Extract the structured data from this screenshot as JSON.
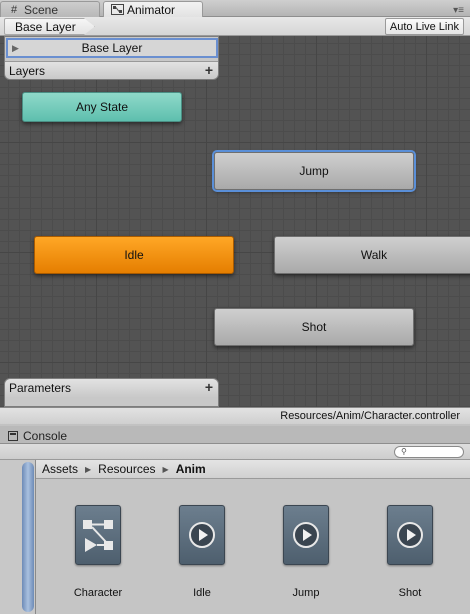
{
  "tabs": [
    {
      "label": "Scene",
      "icon": "scene-grid-icon"
    },
    {
      "label": "Animator",
      "icon": "animator-icon"
    }
  ],
  "animator": {
    "breadcrumb": "Base Layer",
    "auto_live_link": "Auto Live Link",
    "layers": {
      "items": [
        "Base Layer"
      ],
      "header": "Layers",
      "add": "+"
    },
    "states": [
      {
        "name": "Any State",
        "kind": "any-state"
      },
      {
        "name": "Jump",
        "kind": "normal",
        "selected": true
      },
      {
        "name": "Idle",
        "kind": "default"
      },
      {
        "name": "Walk",
        "kind": "normal"
      },
      {
        "name": "Shot",
        "kind": "normal"
      }
    ],
    "parameters": {
      "header": "Parameters",
      "add": "+"
    },
    "path": "Resources/Anim/Character.controller"
  },
  "console": {
    "label": "Console",
    "icon": "console-icon"
  },
  "project": {
    "search_placeholder": "",
    "breadcrumb": [
      "Assets",
      "Resources",
      "Anim"
    ],
    "assets": [
      {
        "name": "Character",
        "icon": "animator-controller-icon"
      },
      {
        "name": "Idle",
        "icon": "animation-clip-icon"
      },
      {
        "name": "Jump",
        "icon": "animation-clip-icon"
      },
      {
        "name": "Shot",
        "icon": "animation-clip-icon"
      }
    ]
  },
  "colors": {
    "any_state": "#5ebfae",
    "default_state": "#f08a00",
    "selection": "#5a8fd8",
    "graph_bg": "#535353"
  }
}
